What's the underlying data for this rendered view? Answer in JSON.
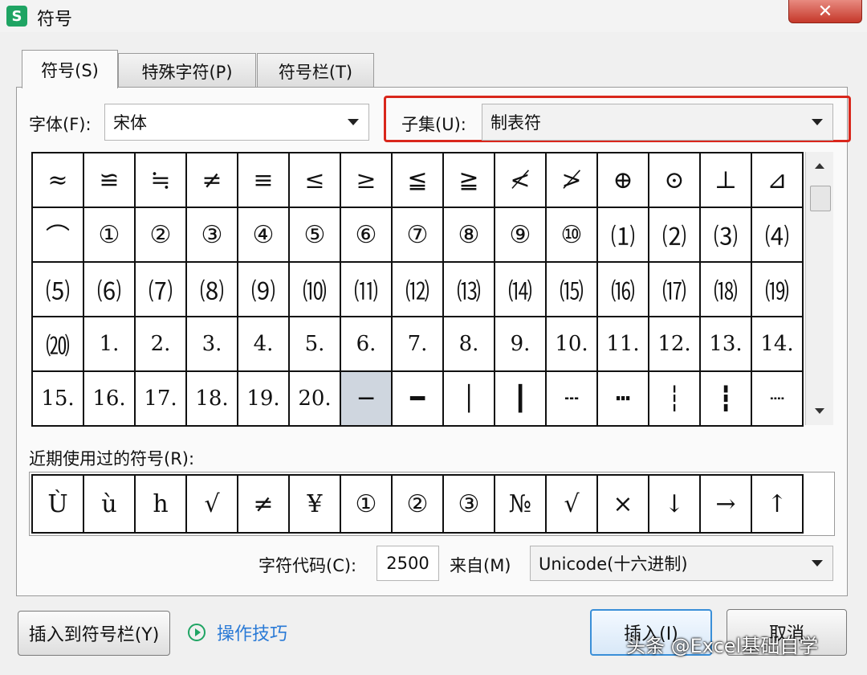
{
  "window": {
    "title": "符号",
    "app_icon": "S",
    "close_label": "✕"
  },
  "tabs": [
    {
      "label": "符号(S)",
      "active": true
    },
    {
      "label": "特殊字符(P)",
      "active": false
    },
    {
      "label": "符号栏(T)",
      "active": false
    }
  ],
  "font": {
    "label": "字体(F):",
    "value": "宋体"
  },
  "subset": {
    "label": "子集(U):",
    "value": "制表符"
  },
  "symbols": [
    "≈",
    "≌",
    "≒",
    "≠",
    "≡",
    "≤",
    "≥",
    "≦",
    "≧",
    "≮",
    "≯",
    "⊕",
    "⊙",
    "⊥",
    "⊿",
    "⌒",
    "①",
    "②",
    "③",
    "④",
    "⑤",
    "⑥",
    "⑦",
    "⑧",
    "⑨",
    "⑩",
    "⑴",
    "⑵",
    "⑶",
    "⑷",
    "⑸",
    "⑹",
    "⑺",
    "⑻",
    "⑼",
    "⑽",
    "⑾",
    "⑿",
    "⒀",
    "⒁",
    "⒂",
    "⒃",
    "⒄",
    "⒅",
    "⒆",
    "⒇",
    "1.",
    "2.",
    "3.",
    "4.",
    "5.",
    "6.",
    "7.",
    "8.",
    "9.",
    "10.",
    "11.",
    "12.",
    "13.",
    "14.",
    "15.",
    "16.",
    "17.",
    "18.",
    "19.",
    "20.",
    "─",
    "━",
    "│",
    "┃",
    "┄",
    "┅",
    "┆",
    "┇",
    "┈"
  ],
  "selected_index": 66,
  "recent": {
    "label": "近期使用过的符号(R):",
    "symbols": [
      "Ù",
      "ù",
      "h",
      "√",
      "≠",
      "¥",
      "①",
      "②",
      "③",
      "№",
      "√",
      "×",
      "↓",
      "→",
      "↑"
    ]
  },
  "code": {
    "label": "字符代码(C):",
    "value": "2500"
  },
  "from": {
    "label": "来自(M)",
    "value": "Unicode(十六进制)"
  },
  "buttons": {
    "insert_to_bar": "插入到符号栏(Y)",
    "tips": "操作技巧",
    "insert": "插入(I)",
    "cancel": "取消"
  },
  "watermark": "头条 @Excel基础自学"
}
